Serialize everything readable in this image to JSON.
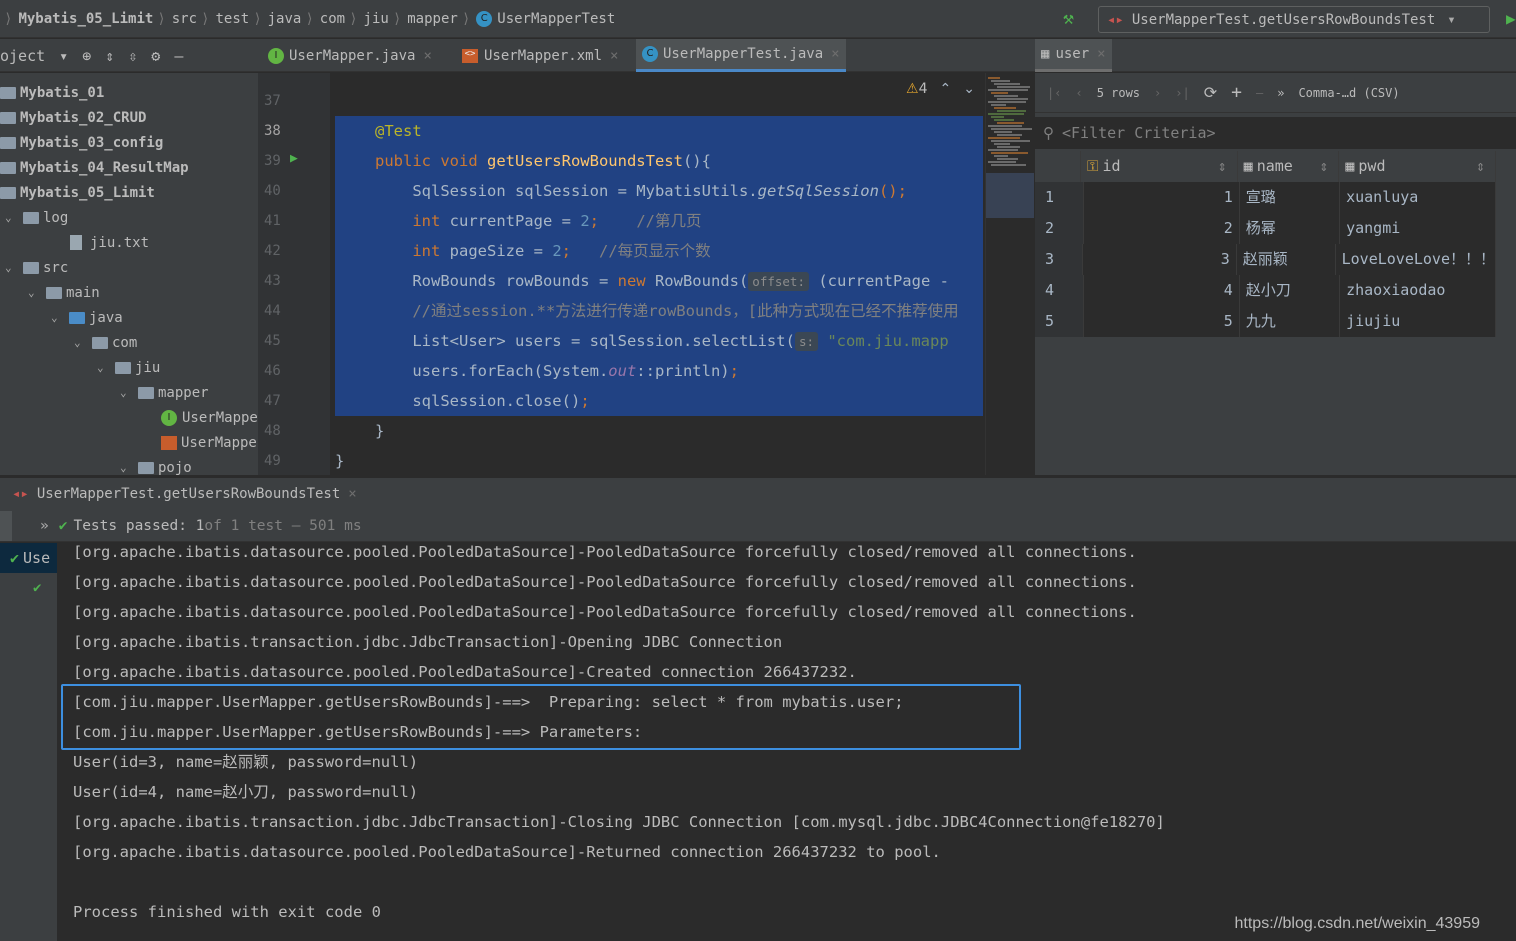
{
  "breadcrumb": [
    "Mybatis_05_Limit",
    "src",
    "test",
    "java",
    "com",
    "jiu",
    "mapper",
    "UserMapperTest"
  ],
  "run_config": "UserMapperTest.getUsersRowBoundsTest",
  "project_label": "oject",
  "editor_tabs": [
    {
      "label": "UserMapper.java",
      "icon": "interface-icon",
      "active": false
    },
    {
      "label": "UserMapper.xml",
      "icon": "xml-icon",
      "active": false
    },
    {
      "label": "UserMapperTest.java",
      "icon": "class-icon",
      "active": true
    }
  ],
  "db_tab": "user",
  "tree": [
    {
      "label": "Mybatis_01",
      "depth": 0,
      "bold": true
    },
    {
      "label": "Mybatis_02_CRUD",
      "depth": 0,
      "bold": true
    },
    {
      "label": "Mybatis_03_config",
      "depth": 0,
      "bold": true
    },
    {
      "label": "Mybatis_04_ResultMap",
      "depth": 0,
      "bold": true
    },
    {
      "label": "Mybatis_05_Limit",
      "depth": 0,
      "bold": true
    },
    {
      "label": "log",
      "depth": 1
    },
    {
      "label": "jiu.txt",
      "depth": 2,
      "file": true
    },
    {
      "label": "src",
      "depth": 1
    },
    {
      "label": "main",
      "depth": 2
    },
    {
      "label": "java",
      "depth": 3,
      "blue": true
    },
    {
      "label": "com",
      "depth": 4
    },
    {
      "label": "jiu",
      "depth": 5
    },
    {
      "label": "mapper",
      "depth": 6
    },
    {
      "label": "UserMappe",
      "depth": 7,
      "file": true,
      "icon": "interface-icon"
    },
    {
      "label": "UserMappe",
      "depth": 7,
      "file": true,
      "icon": "xml-icon"
    },
    {
      "label": "pojo",
      "depth": 6
    }
  ],
  "line_numbers": [
    "37",
    "38",
    "39",
    "40",
    "41",
    "42",
    "43",
    "44",
    "45",
    "46",
    "47",
    "48",
    "49"
  ],
  "warnings": "4",
  "code": [
    [],
    [
      [
        "@Test",
        "an"
      ]
    ],
    [
      [
        "public void ",
        "kw"
      ],
      [
        "getUsersRowBoundsTest",
        "fn"
      ],
      [
        "(){",
        ""
      ]
    ],
    [
      [
        "    SqlSession sqlSession = MybatisUtils.",
        ""
      ],
      [
        "getSqlSession",
        "it"
      ],
      [
        "();",
        "pu"
      ]
    ],
    [
      [
        "    int ",
        "kw"
      ],
      [
        "currentPage = ",
        ""
      ],
      [
        "2",
        "num"
      ],
      [
        ";",
        "pu"
      ],
      [
        "    //第几页",
        "cm"
      ]
    ],
    [
      [
        "    int ",
        "kw"
      ],
      [
        "pageSize = ",
        ""
      ],
      [
        "2",
        "num"
      ],
      [
        ";",
        "pu"
      ],
      [
        "   //每页显示个数",
        "cm"
      ]
    ],
    [
      [
        "    RowBounds rowBounds = ",
        ""
      ],
      [
        "new ",
        "kw"
      ],
      [
        "RowBounds(",
        ""
      ],
      [
        "offset:",
        "hint"
      ],
      [
        " (currentPage - ",
        ""
      ]
    ],
    [
      [
        "    //通过session.**方法进行传递rowBounds，[此种方式现在已经不推荐使用",
        "cm"
      ]
    ],
    [
      [
        "    List<User> users = sqlSession.selectList(",
        ""
      ],
      [
        "s:",
        "hint"
      ],
      [
        " \"com.jiu.mapp",
        "st"
      ]
    ],
    [
      [
        "    users.forEach(System.",
        ""
      ],
      [
        "out",
        "fld"
      ],
      [
        "::println)",
        ""
      ],
      [
        ";",
        "pu"
      ]
    ],
    [
      [
        "    sqlSession.close()",
        ""
      ],
      [
        ";",
        "pu"
      ]
    ],
    [
      [
        "}",
        ""
      ]
    ],
    [
      [
        "}",
        ""
      ]
    ]
  ],
  "db": {
    "rows_label": "5 rows",
    "format": "Comma-…d (CSV)",
    "filter_placeholder": "<Filter Criteria>",
    "columns": [
      "id",
      "name",
      "pwd"
    ],
    "rows": [
      [
        "1",
        "1",
        "宣璐",
        "xuanluya"
      ],
      [
        "2",
        "2",
        "杨幂",
        "yangmi"
      ],
      [
        "3",
        "3",
        "赵丽颖",
        "LoveLoveLove！！！"
      ],
      [
        "4",
        "4",
        "赵小刀",
        "zhaoxiaodao"
      ],
      [
        "5",
        "5",
        "九九",
        "jiujiu"
      ]
    ]
  },
  "run": {
    "tab": "UserMapperTest.getUsersRowBoundsTest",
    "status_a": "Tests passed: 1",
    "status_b": " of 1 test – 501 ms",
    "tree_item": "Use"
  },
  "console": [
    "[org.apache.ibatis.datasource.pooled.PooledDataSource]-PooledDataSource forcefully closed/removed all connections.",
    "[org.apache.ibatis.datasource.pooled.PooledDataSource]-PooledDataSource forcefully closed/removed all connections.",
    "[org.apache.ibatis.datasource.pooled.PooledDataSource]-PooledDataSource forcefully closed/removed all connections.",
    "[org.apache.ibatis.transaction.jdbc.JdbcTransaction]-Opening JDBC Connection",
    "[org.apache.ibatis.datasource.pooled.PooledDataSource]-Created connection 266437232.",
    "[com.jiu.mapper.UserMapper.getUsersRowBounds]-==>  Preparing: select * from mybatis.user;",
    "[com.jiu.mapper.UserMapper.getUsersRowBounds]-==> Parameters: ",
    "User(id=3, name=赵丽颖, password=null)",
    "User(id=4, name=赵小刀, password=null)",
    "[org.apache.ibatis.transaction.jdbc.JdbcTransaction]-Closing JDBC Connection [com.mysql.jdbc.JDBC4Connection@fe18270]",
    "[org.apache.ibatis.datasource.pooled.PooledDataSource]-Returned connection 266437232 to pool.",
    "",
    "Process finished with exit code 0"
  ],
  "watermark": "https://blog.csdn.net/weixin_43959"
}
